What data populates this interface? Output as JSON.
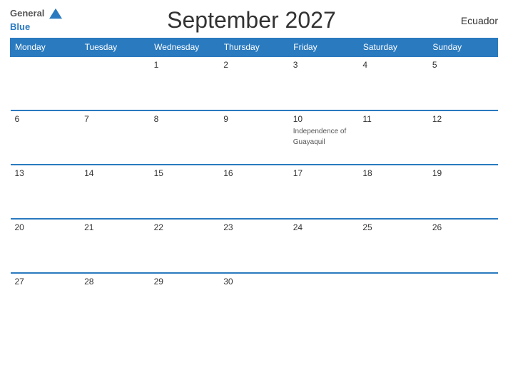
{
  "header": {
    "logo_general": "General",
    "logo_blue": "Blue",
    "title": "September 2027",
    "country": "Ecuador"
  },
  "calendar": {
    "weekdays": [
      "Monday",
      "Tuesday",
      "Wednesday",
      "Thursday",
      "Friday",
      "Saturday",
      "Sunday"
    ],
    "weeks": [
      [
        {
          "date": "",
          "empty": true
        },
        {
          "date": "",
          "empty": true
        },
        {
          "date": "1",
          "empty": false
        },
        {
          "date": "2",
          "empty": false
        },
        {
          "date": "3",
          "empty": false
        },
        {
          "date": "4",
          "empty": false
        },
        {
          "date": "5",
          "empty": false
        }
      ],
      [
        {
          "date": "6",
          "empty": false
        },
        {
          "date": "7",
          "empty": false
        },
        {
          "date": "8",
          "empty": false
        },
        {
          "date": "9",
          "empty": false
        },
        {
          "date": "10",
          "empty": false,
          "holiday": "Independence of Guayaquil"
        },
        {
          "date": "11",
          "empty": false
        },
        {
          "date": "12",
          "empty": false
        }
      ],
      [
        {
          "date": "13",
          "empty": false
        },
        {
          "date": "14",
          "empty": false
        },
        {
          "date": "15",
          "empty": false
        },
        {
          "date": "16",
          "empty": false
        },
        {
          "date": "17",
          "empty": false
        },
        {
          "date": "18",
          "empty": false
        },
        {
          "date": "19",
          "empty": false
        }
      ],
      [
        {
          "date": "20",
          "empty": false
        },
        {
          "date": "21",
          "empty": false
        },
        {
          "date": "22",
          "empty": false
        },
        {
          "date": "23",
          "empty": false
        },
        {
          "date": "24",
          "empty": false
        },
        {
          "date": "25",
          "empty": false
        },
        {
          "date": "26",
          "empty": false
        }
      ],
      [
        {
          "date": "27",
          "empty": false
        },
        {
          "date": "28",
          "empty": false
        },
        {
          "date": "29",
          "empty": false
        },
        {
          "date": "30",
          "empty": false
        },
        {
          "date": "",
          "empty": true
        },
        {
          "date": "",
          "empty": true
        },
        {
          "date": "",
          "empty": true
        }
      ]
    ]
  }
}
